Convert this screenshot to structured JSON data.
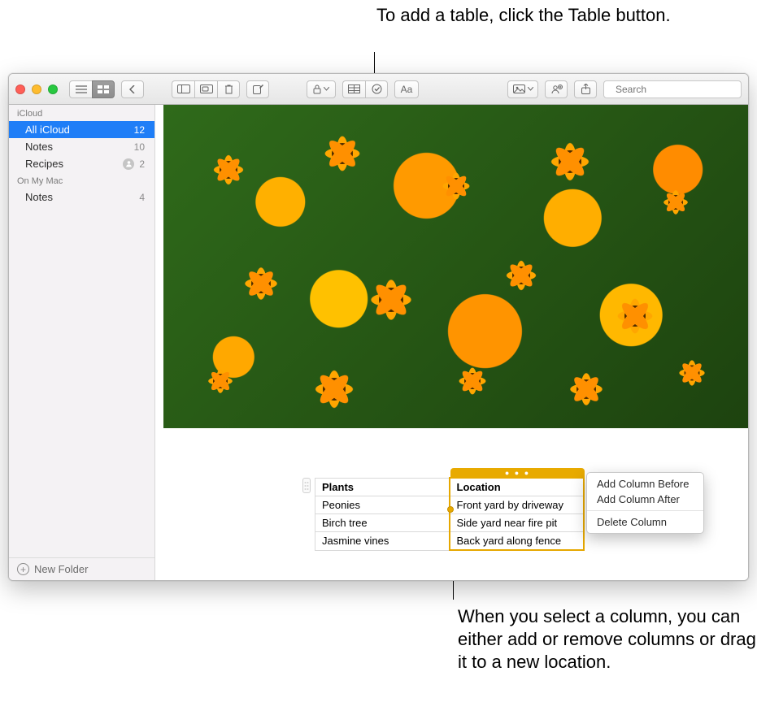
{
  "callouts": {
    "top": "To add a table, click the Table button.",
    "bottom": "When you select a column, you can either add or remove columns or drag it to a new location."
  },
  "toolbar": {
    "search_placeholder": "Search"
  },
  "sidebar": {
    "sections": [
      {
        "heading": "iCloud",
        "items": [
          {
            "label": "All iCloud",
            "count": "12",
            "selected": true,
            "shared": false
          },
          {
            "label": "Notes",
            "count": "10",
            "selected": false,
            "shared": false
          },
          {
            "label": "Recipes",
            "count": "2",
            "selected": false,
            "shared": true
          }
        ]
      },
      {
        "heading": "On My Mac",
        "items": [
          {
            "label": "Notes",
            "count": "4",
            "selected": false,
            "shared": false
          }
        ]
      }
    ],
    "new_folder_label": "New Folder"
  },
  "note_table": {
    "headers": [
      "Plants",
      "Location"
    ],
    "rows": [
      [
        "Peonies",
        "Front yard by driveway"
      ],
      [
        "Birch tree",
        "Side yard near fire pit"
      ],
      [
        "Jasmine vines",
        "Back yard along fence"
      ]
    ]
  },
  "context_menu": {
    "add_before": "Add Column Before",
    "add_after": "Add Column After",
    "delete": "Delete Column"
  }
}
